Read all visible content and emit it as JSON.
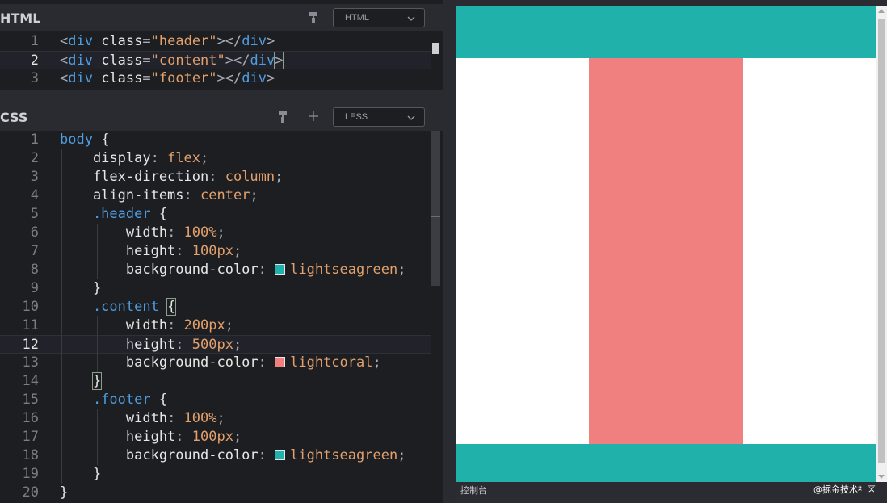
{
  "html_panel": {
    "title": "HTML",
    "preprocessor": "HTML",
    "lines": [
      {
        "n": "1",
        "tokens": [
          [
            "t-punc",
            "<"
          ],
          [
            "t-tag",
            "div"
          ],
          [
            "t-attr",
            " class"
          ],
          [
            "t-punc",
            "="
          ],
          [
            "t-str",
            "\"header\""
          ],
          [
            "t-punc",
            "></"
          ],
          [
            "t-tag",
            "div"
          ],
          [
            "t-punc",
            ">"
          ]
        ]
      },
      {
        "n": "2",
        "tokens": [
          [
            "t-punc",
            "<"
          ],
          [
            "t-tag",
            "div"
          ],
          [
            "t-attr",
            " class"
          ],
          [
            "t-punc",
            "="
          ],
          [
            "t-str",
            "\"content\""
          ],
          [
            "t-punc",
            ">"
          ],
          [
            "t-punc hl",
            "<"
          ],
          [
            "t-punc",
            "/"
          ],
          [
            "t-tag",
            "div"
          ],
          [
            "t-punc hl",
            ">"
          ]
        ]
      },
      {
        "n": "3",
        "tokens": [
          [
            "t-punc",
            "<"
          ],
          [
            "t-tag",
            "div"
          ],
          [
            "t-attr",
            " class"
          ],
          [
            "t-punc",
            "="
          ],
          [
            "t-str",
            "\"footer\""
          ],
          [
            "t-punc",
            "></"
          ],
          [
            "t-tag",
            "div"
          ],
          [
            "t-punc",
            ">"
          ]
        ]
      }
    ]
  },
  "css_panel": {
    "title": "CSS",
    "preprocessor": "LESS",
    "lines": [
      {
        "n": "1",
        "tokens": [
          [
            "t-sel",
            "body"
          ],
          [
            "t-brace",
            " {"
          ]
        ]
      },
      {
        "n": "2",
        "tokens": [
          [
            "t-prop",
            "    display"
          ],
          [
            "t-punc",
            ": "
          ],
          [
            "t-val",
            "flex"
          ],
          [
            "t-punc",
            ";"
          ]
        ]
      },
      {
        "n": "3",
        "tokens": [
          [
            "t-prop",
            "    flex-direction"
          ],
          [
            "t-punc",
            ": "
          ],
          [
            "t-val",
            "column"
          ],
          [
            "t-punc",
            ";"
          ]
        ]
      },
      {
        "n": "4",
        "tokens": [
          [
            "t-prop",
            "    align-items"
          ],
          [
            "t-punc",
            ": "
          ],
          [
            "t-val",
            "center"
          ],
          [
            "t-punc",
            ";"
          ]
        ]
      },
      {
        "n": "5",
        "tokens": [
          [
            "t-sel",
            "    .header"
          ],
          [
            "t-brace",
            " {"
          ]
        ]
      },
      {
        "n": "6",
        "tokens": [
          [
            "t-prop",
            "        width"
          ],
          [
            "t-punc",
            ": "
          ],
          [
            "t-val",
            "100%"
          ],
          [
            "t-punc",
            ";"
          ]
        ]
      },
      {
        "n": "7",
        "tokens": [
          [
            "t-prop",
            "        height"
          ],
          [
            "t-punc",
            ": "
          ],
          [
            "t-val",
            "100px"
          ],
          [
            "t-punc",
            ";"
          ]
        ]
      },
      {
        "n": "8",
        "tokens": [
          [
            "t-prop",
            "        background-color"
          ],
          [
            "t-punc",
            ": "
          ],
          [
            "swatch",
            "#20b2aa"
          ],
          [
            "t-val",
            "lightseagreen"
          ],
          [
            "t-punc",
            ";"
          ]
        ]
      },
      {
        "n": "9",
        "tokens": [
          [
            "t-brace",
            "    }"
          ]
        ]
      },
      {
        "n": "10",
        "tokens": [
          [
            "t-sel",
            "    .content"
          ],
          [
            "t-brace",
            " "
          ],
          [
            "t-brace hl",
            "{"
          ]
        ]
      },
      {
        "n": "11",
        "tokens": [
          [
            "t-prop",
            "        width"
          ],
          [
            "t-punc",
            ": "
          ],
          [
            "t-val",
            "200px"
          ],
          [
            "t-punc",
            ";"
          ]
        ]
      },
      {
        "n": "12",
        "tokens": [
          [
            "t-prop",
            "        height"
          ],
          [
            "t-punc",
            ": "
          ],
          [
            "t-val",
            "500px"
          ],
          [
            "t-punc",
            ";"
          ]
        ]
      },
      {
        "n": "13",
        "tokens": [
          [
            "t-prop",
            "        background-color"
          ],
          [
            "t-punc",
            ": "
          ],
          [
            "swatch",
            "#f08080"
          ],
          [
            "t-val",
            "lightcoral"
          ],
          [
            "t-punc",
            ";"
          ]
        ]
      },
      {
        "n": "14",
        "tokens": [
          [
            "t-brace",
            "    "
          ],
          [
            "t-brace hl",
            "}"
          ]
        ]
      },
      {
        "n": "15",
        "tokens": [
          [
            "t-sel",
            "    .footer"
          ],
          [
            "t-brace",
            " {"
          ]
        ]
      },
      {
        "n": "16",
        "tokens": [
          [
            "t-prop",
            "        width"
          ],
          [
            "t-punc",
            ": "
          ],
          [
            "t-val",
            "100%"
          ],
          [
            "t-punc",
            ";"
          ]
        ]
      },
      {
        "n": "17",
        "tokens": [
          [
            "t-prop",
            "        height"
          ],
          [
            "t-punc",
            ": "
          ],
          [
            "t-val",
            "100px"
          ],
          [
            "t-punc",
            ";"
          ]
        ]
      },
      {
        "n": "18",
        "tokens": [
          [
            "t-prop",
            "        background-color"
          ],
          [
            "t-punc",
            ": "
          ],
          [
            "swatch",
            "#20b2aa"
          ],
          [
            "t-val",
            "lightseagreen"
          ],
          [
            "t-punc",
            ";"
          ]
        ]
      },
      {
        "n": "19",
        "tokens": [
          [
            "t-brace",
            "    }"
          ]
        ]
      },
      {
        "n": "20",
        "tokens": [
          [
            "t-brace",
            "}"
          ]
        ]
      }
    ]
  },
  "preview": {
    "header_color": "#20b2aa",
    "content_color": "#f08080",
    "footer_color": "#20b2aa"
  },
  "console_label": "控制台",
  "watermark": "@掘金技术社区"
}
